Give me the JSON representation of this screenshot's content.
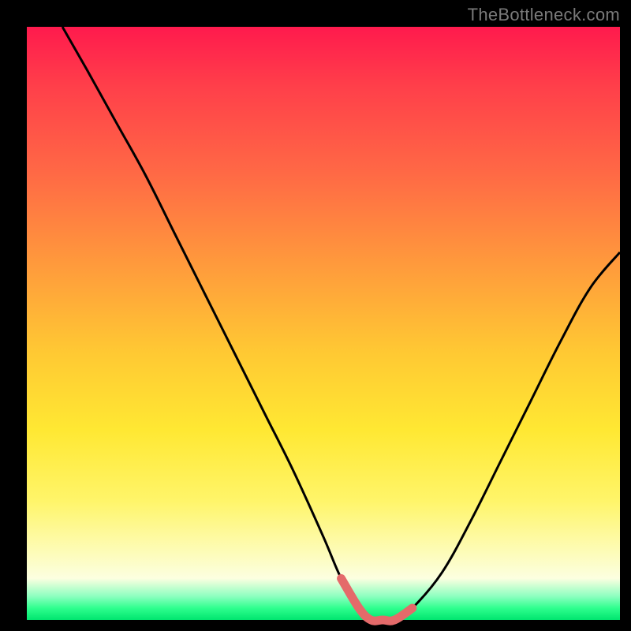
{
  "watermark": "TheBottleneck.com",
  "colors": {
    "frame": "#000000",
    "gradient_top": "#ff1a4d",
    "gradient_mid1": "#ff9a3c",
    "gradient_mid2": "#ffe833",
    "gradient_pale": "#fcffe0",
    "gradient_bottom": "#00e56f",
    "curve_stroke": "#000000",
    "highlight_stroke": "#e46a6a"
  },
  "chart_data": {
    "type": "line",
    "title": "",
    "xlabel": "",
    "ylabel": "",
    "xlim": [
      0,
      100
    ],
    "ylim": [
      0,
      100
    ],
    "grid": false,
    "legend": false,
    "series": [
      {
        "name": "bottleneck-curve",
        "x": [
          6,
          10,
          15,
          20,
          25,
          30,
          35,
          40,
          45,
          50,
          53,
          56,
          58,
          60,
          62,
          65,
          70,
          75,
          80,
          85,
          90,
          95,
          100
        ],
        "y": [
          100,
          93,
          84,
          75,
          65,
          55,
          45,
          35,
          25,
          14,
          7,
          2,
          0,
          0,
          0,
          2,
          8,
          17,
          27,
          37,
          47,
          56,
          62
        ]
      }
    ],
    "highlight_segment": {
      "name": "trough-marker",
      "x_range": [
        53,
        65
      ],
      "y": [
        7,
        2,
        0,
        0,
        0,
        2
      ]
    }
  }
}
